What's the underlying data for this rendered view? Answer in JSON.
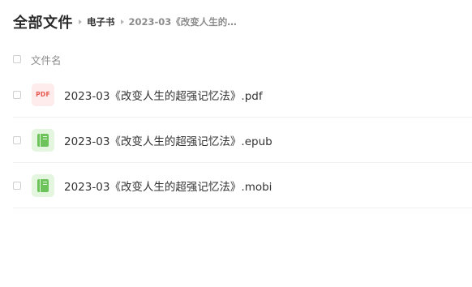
{
  "breadcrumb": {
    "root": "全部文件",
    "folder": "电子书",
    "current": "2023-03《改变人生的…"
  },
  "list": {
    "header": "文件名",
    "files": [
      {
        "name": "2023-03《改变人生的超强记忆法》.pdf",
        "icon": "pdf-file-icon",
        "icon_text": "PDF"
      },
      {
        "name": "2023-03《改变人生的超强记忆法》.epub",
        "icon": "ebook-icon"
      },
      {
        "name": "2023-03《改变人生的超强记忆法》.mobi",
        "icon": "ebook-icon"
      }
    ]
  },
  "colors": {
    "pdf_red": "#e8574e",
    "pdf_bg": "#fdeceb",
    "book_green": "#6cc35a",
    "book_bg": "#e4f6df"
  }
}
